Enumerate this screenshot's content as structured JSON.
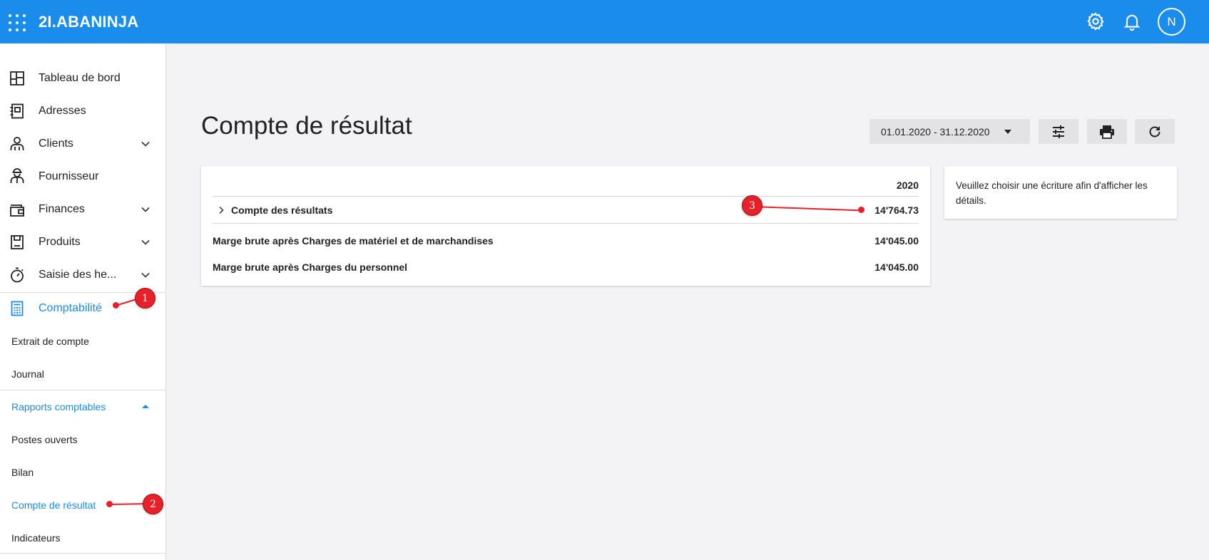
{
  "topbar": {
    "logo": "2I.ABANINJA",
    "avatar_initial": "N",
    "brand_color": "#1a8cec"
  },
  "sidebar": {
    "items": [
      {
        "label": "Tableau de bord",
        "icon": "dashboard-icon"
      },
      {
        "label": "Adresses",
        "icon": "address-book-icon"
      },
      {
        "label": "Clients",
        "icon": "clients-icon"
      },
      {
        "label": "Fournisseur",
        "icon": "supplier-icon"
      },
      {
        "label": "Finances",
        "icon": "wallet-icon"
      },
      {
        "label": "Produits",
        "icon": "product-icon"
      },
      {
        "label": "Saisie des he...",
        "icon": "stopwatch-icon"
      },
      {
        "label": "Comptabilité",
        "icon": "calculator-icon"
      }
    ],
    "sub_items": [
      {
        "label": "Extrait de compte"
      },
      {
        "label": "Journal"
      },
      {
        "label": "Rapports comptables"
      },
      {
        "label": "Postes ouverts"
      },
      {
        "label": "Bilan"
      },
      {
        "label": "Compte de résultat"
      },
      {
        "label": "Indicateurs"
      }
    ]
  },
  "main": {
    "title": "Compte de résultat",
    "date_range": "01.01.2020 - 31.12.2020",
    "table": {
      "year": "2020",
      "rows": [
        {
          "label": "Compte des résultats",
          "value": "14'764.73"
        },
        {
          "label": "Marge brute après Charges de matériel et de marchandises",
          "value": "14'045.00"
        },
        {
          "label": "Marge brute après Charges du personnel",
          "value": "14'045.00"
        }
      ]
    },
    "detail_text": "Veuillez choisir une écriture afin d'afficher les détails."
  },
  "annotations": [
    "1",
    "2",
    "3"
  ]
}
